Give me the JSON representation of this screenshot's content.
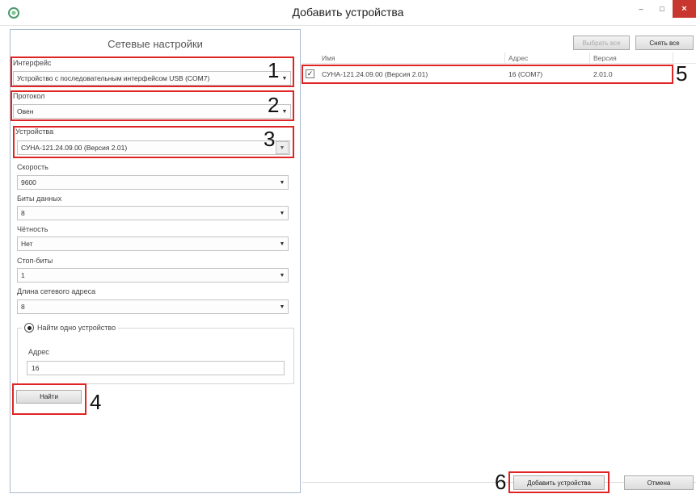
{
  "window": {
    "title": "Добавить устройства",
    "minimize_glyph": "–",
    "maximize_glyph": "□",
    "close_glyph": "×"
  },
  "left": {
    "title": "Сетевые настройки",
    "interface": {
      "label": "Интерфейс",
      "value": "Устройство с последовательным интерфейсом USB (COM7)",
      "callout": "1"
    },
    "protocol": {
      "label": "Протокол",
      "value": "Овен",
      "callout": "2"
    },
    "devices": {
      "label": "Устройства",
      "value": "СУНА-121.24.09.00 (Версия 2.01)",
      "callout": "3"
    },
    "speed": {
      "label": "Скорость",
      "value": "9600"
    },
    "data_bits": {
      "label": "Биты данных",
      "value": "8"
    },
    "parity": {
      "label": "Чётность",
      "value": "Нет"
    },
    "stop_bits": {
      "label": "Стоп-биты",
      "value": "1"
    },
    "address_length": {
      "label": "Длина сетевого адреса",
      "value": "8"
    },
    "find_one": {
      "label": "Найти одно устройство",
      "selected": true
    },
    "address": {
      "label": "Адрес",
      "value": "16"
    },
    "find_button": {
      "label": "Найти",
      "callout": "4"
    }
  },
  "right": {
    "select_all": "Выбрать все",
    "unselect_all": "Снять все",
    "columns": [
      "Имя",
      "Адрес",
      "Версия"
    ],
    "rows": [
      {
        "checked": true,
        "name": "СУНА-121.24.09.00 (Версия 2.01)",
        "address": "16 (COM7)",
        "version": "2.01.0"
      }
    ],
    "rows_callout": "5",
    "add_button": {
      "label": "Добавить устройства",
      "callout": "6"
    },
    "cancel_button": {
      "label": "Отмена"
    }
  },
  "colors": {
    "callout_red": "#e02424",
    "close_red": "#c7372f",
    "app_icon_green": "#4a9a6a"
  }
}
